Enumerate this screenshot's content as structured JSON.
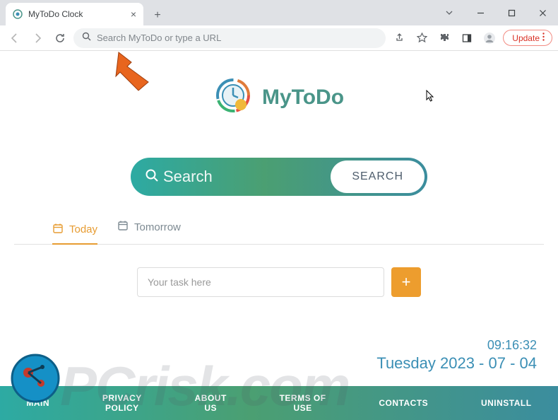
{
  "browser": {
    "tab_title": "MyToDo Clock",
    "omnibox_placeholder": "Search MyToDo or type a URL",
    "update_label": "Update"
  },
  "page": {
    "brand": "MyToDo",
    "search_placeholder": "Search",
    "search_button": "SEARCH",
    "tabs": {
      "today": "Today",
      "tomorrow": "Tomorrow"
    },
    "task_placeholder": "Your task here",
    "clock": {
      "time": "09:16:32",
      "date": "Tuesday 2023 - 07 - 04"
    }
  },
  "footer": {
    "main": "MAIN",
    "privacy_l1": "PRIVACY",
    "privacy_l2": "POLICY",
    "about_l1": "ABOUT",
    "about_l2": "US",
    "terms_l1": "TERMS OF",
    "terms_l2": "USE",
    "contacts": "CONTACTS",
    "uninstall": "UNINSTALL"
  },
  "watermark": "PCrisk.com"
}
